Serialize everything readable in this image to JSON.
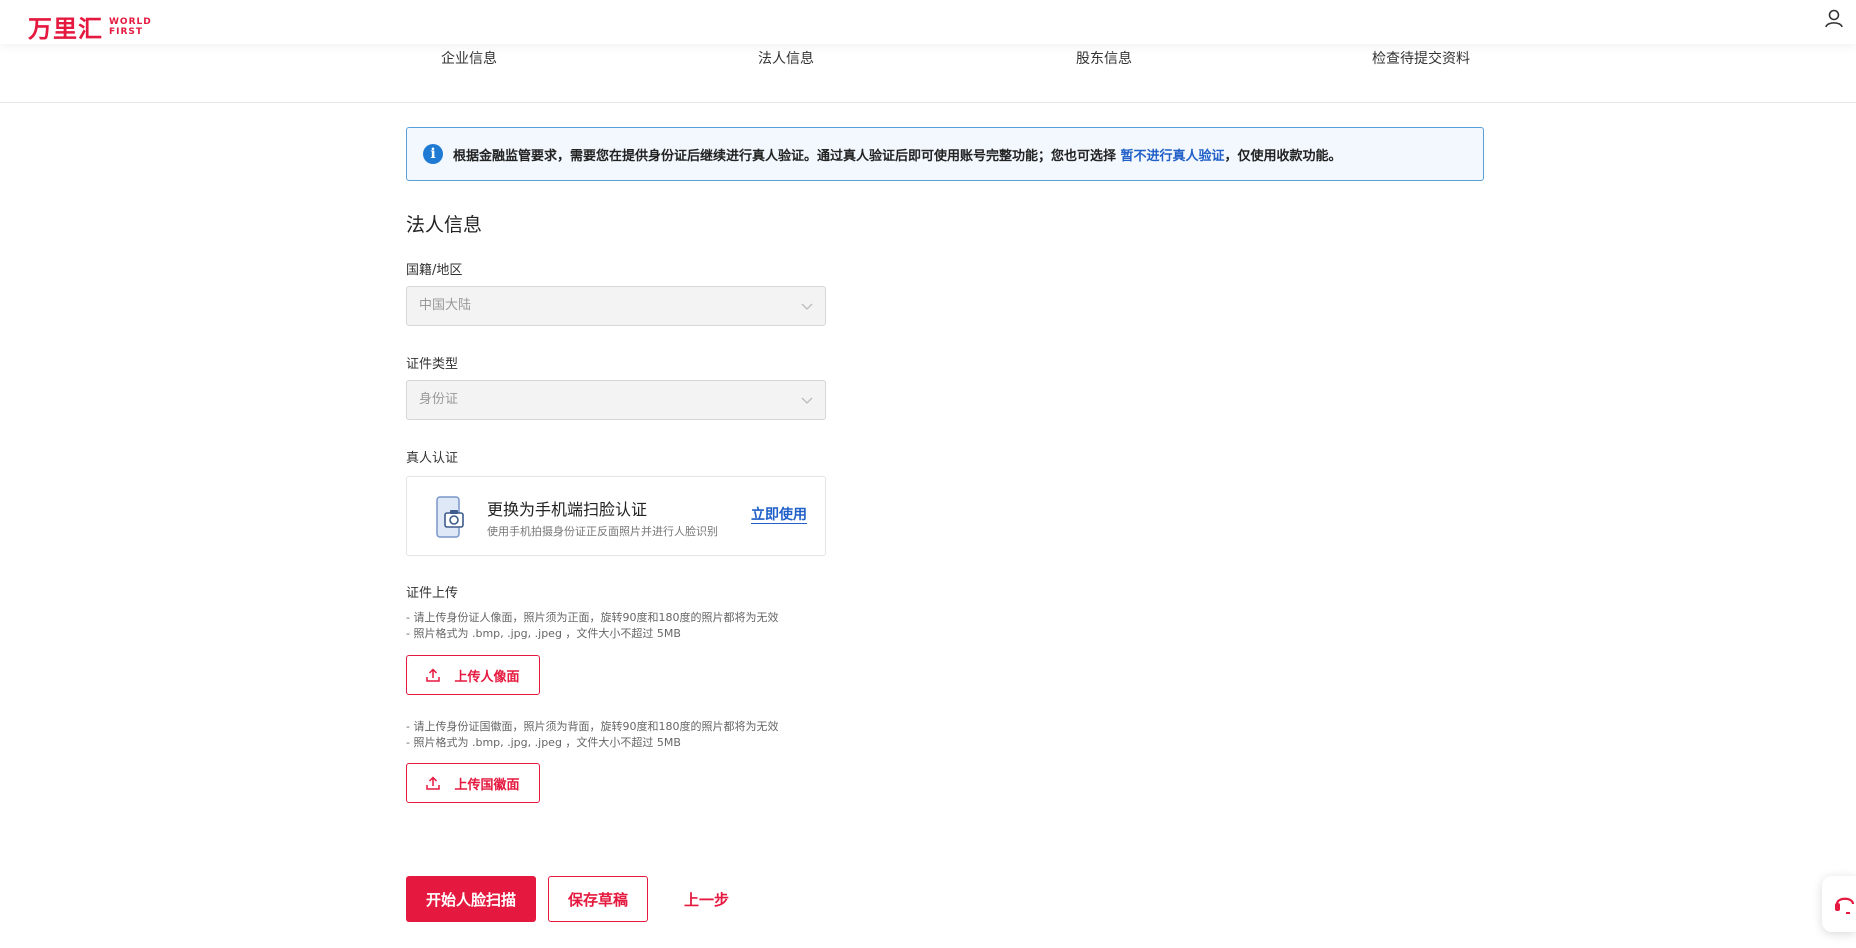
{
  "header": {
    "logo_cn": "万里汇",
    "logo_en_line1": "WORLD",
    "logo_en_line2": "FIRST"
  },
  "steps": [
    "企业信息",
    "法人信息",
    "股东信息",
    "检查待提交资料"
  ],
  "notice": {
    "text_before": "根据金融监管要求，需要您在提供身份证后继续进行真人验证。通过真人验证后即可使用账号完整功能；您也可选择 ",
    "link": "暂不进行真人验证",
    "text_after": "，仅使用收款功能。"
  },
  "section_title": "法人信息",
  "nationality": {
    "label": "国籍/地区",
    "value": "中国大陆"
  },
  "id_type": {
    "label": "证件类型",
    "value": "身份证"
  },
  "face_verify": {
    "label": "真人认证",
    "title": "更换为手机端扫脸认证",
    "desc": "使用手机拍摄身份证正反面照片并进行人脸识别",
    "link": "立即使用"
  },
  "upload": {
    "label": "证件上传",
    "front_hint1": "- 请上传身份证人像面，照片须为正面，旋转90度和180度的照片都将为无效",
    "front_hint2": "- 照片格式为 .bmp, .jpg, .jpeg ，文件大小不超过 5MB",
    "front_button": "上传人像面",
    "back_hint1": "- 请上传身份证国徽面，照片须为背面，旋转90度和180度的照片都将为无效",
    "back_hint2": "- 照片格式为 .bmp, .jpg, .jpeg ，文件大小不超过 5MB",
    "back_button": "上传国徽面"
  },
  "actions": {
    "start_scan": "开始人脸扫描",
    "save_draft": "保存草稿",
    "prev_step": "上一步"
  },
  "colors": {
    "brand_red": "#e5193f",
    "link_blue": "#2060c8",
    "info_blue": "#1f7ad4",
    "notice_bg": "#f2f8fd"
  },
  "icons": [
    "user-icon",
    "info-icon",
    "chevron-down-icon",
    "phone-camera-icon",
    "upload-icon",
    "customer-service-icon"
  ]
}
